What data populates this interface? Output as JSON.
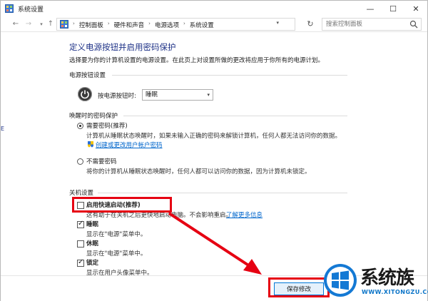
{
  "window": {
    "title": "系统设置",
    "minimize": "—",
    "maximize": "☐",
    "close": "✕"
  },
  "address": {
    "back": "←",
    "forward": "→",
    "dropdown": "▾",
    "up": "↑",
    "crumbs": [
      "控制面板",
      "硬件和声音",
      "电源选项",
      "系统设置"
    ],
    "crumb_sep": "›",
    "refresh": "↻",
    "search_placeholder": "搜索控制面板"
  },
  "page": {
    "title": "定义电源按钮并启用密码保护",
    "description": "选择要为你的计算机设置的电源设置。在此页上对设置所做的更改将应用于你所有的电源计划。"
  },
  "power_button": {
    "group_label": "电源按钮设置",
    "label": "按电源按钮时:",
    "selected": "睡眠",
    "arrow": "▾"
  },
  "wake_password": {
    "group_label": "唤醒时的密码保护",
    "require": {
      "title": "需要密码(推荐)",
      "desc": "计算机从睡眠状态唤醒时，如果未输入正确的密码来解锁计算机，任何人都无法访问你的数据。",
      "link": "创建或更改用户帐户密码",
      "checked": true
    },
    "no_require": {
      "title": "不需要密码",
      "desc": "将你的计算机从睡眠状态唤醒时，任何人都可以访问你的数据，因为计算机未锁定。",
      "checked": false
    }
  },
  "shutdown": {
    "group_label": "关机设置",
    "items": [
      {
        "title": "启用快速启动(推荐)",
        "desc": "这有助于在关机之后更快地启动电脑。不会影响重启。",
        "link": "了解更多信息",
        "checked": false
      },
      {
        "title": "睡眠",
        "desc": "显示在\"电源\"菜单中。",
        "checked": true
      },
      {
        "title": "休眠",
        "desc": "显示在\"电源\"菜单中。",
        "checked": false
      },
      {
        "title": "锁定",
        "desc": "显示在用户头像菜单中。",
        "checked": true
      }
    ]
  },
  "footer": {
    "save_label": "保存修改"
  },
  "watermark": {
    "brand": "系统族",
    "url": "WWW.XITONGZU.COM"
  },
  "left_edge": "E",
  "colors": {
    "accent": "#1e3287",
    "link": "#0066cc",
    "annotation": "#e60012"
  }
}
